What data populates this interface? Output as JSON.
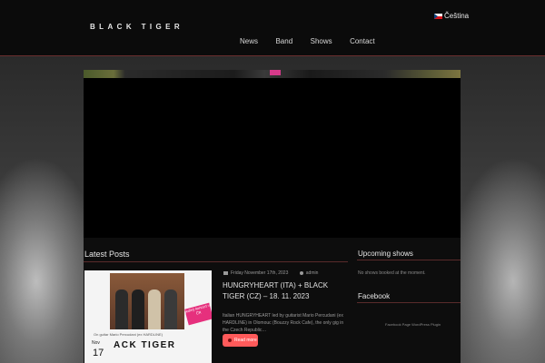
{
  "site": {
    "logo": "BLACK TIGER"
  },
  "nav": {
    "items": [
      "News",
      "Band",
      "Shows",
      "Contact"
    ]
  },
  "language": {
    "label": "Čeština"
  },
  "latest": {
    "title": "Latest Posts",
    "post": {
      "date_meta": "Friday November 17th, 2023",
      "author": "admin",
      "title": "HUNGRYHEART (ITA) + BLACK TIGER (CZ) – 18. 11. 2023",
      "excerpt": "Italian HUNGRYHEART led by guitarist Mario Percudani (ex HARDLINE) in Olomouc (Bouzzy Rock Cafe), the only gig in the Czech Republic…",
      "read_more": "Read more",
      "thumb": {
        "month": "Nov",
        "day": "17",
        "caption": "On guitar Mario Percudani (ex HARDLINE)",
        "title": "ACK TIGER",
        "badge": "jediný koncert v ČR"
      }
    }
  },
  "sidebar": {
    "shows_title": "Upcoming shows",
    "shows_text": "No shows booked at the moment.",
    "facebook_title": "Facebook",
    "facebook_text": "Facebook Page WordPress Plugin"
  },
  "colors": {
    "accent": "#ff5a5a",
    "rule": "#5a2b2b"
  }
}
